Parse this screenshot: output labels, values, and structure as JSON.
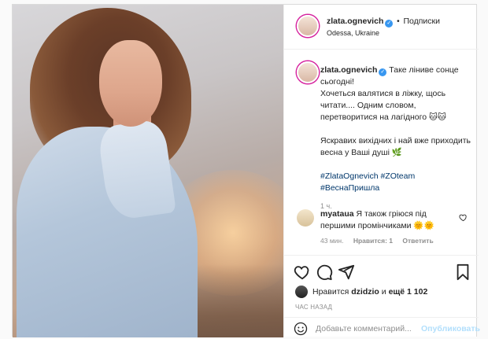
{
  "post": {
    "author": {
      "username": "zlata.ognevich",
      "location": "Odessa, Ukraine",
      "follow_label": "Подписки",
      "separator": "•"
    },
    "caption": {
      "username": "zlata.ognevich",
      "line1": "Таке ліниве сонце сьогодні!",
      "line2": "Хочеться валятися в ліжку, щось читати.... Одним словом, перетворитися на лагідного 🐱🐱",
      "line3": "Яскравих вихідних і най вже приходить весна у Ваші душі 🌿",
      "hashtags": "#ZlataOgnevich #ZOteam #ВеснаПришла",
      "time": "1 ч."
    },
    "comments": [
      {
        "username": "myataua",
        "text": "Я також гріюся під першими промінчиками 🌞🌞",
        "time": "43 мин.",
        "likes": "Нравится: 1",
        "reply": "Ответить"
      }
    ],
    "likes": {
      "prefix": "Нравится",
      "user": "dzidzio",
      "middle": "и",
      "rest": "ещё 1 102"
    },
    "posted_time": "ЧАС НАЗАД",
    "add_comment": {
      "placeholder": "Добавьте комментарий...",
      "publish": "Опубликовать"
    }
  },
  "icons": [
    "heart-icon",
    "comment-icon",
    "share-icon",
    "bookmark-icon",
    "emoji-icon",
    "verified-icon"
  ],
  "colors": {
    "link": "#00376b",
    "publish": "#b2dffc",
    "verified": "#3897f0",
    "muted": "#8e8e8e"
  }
}
